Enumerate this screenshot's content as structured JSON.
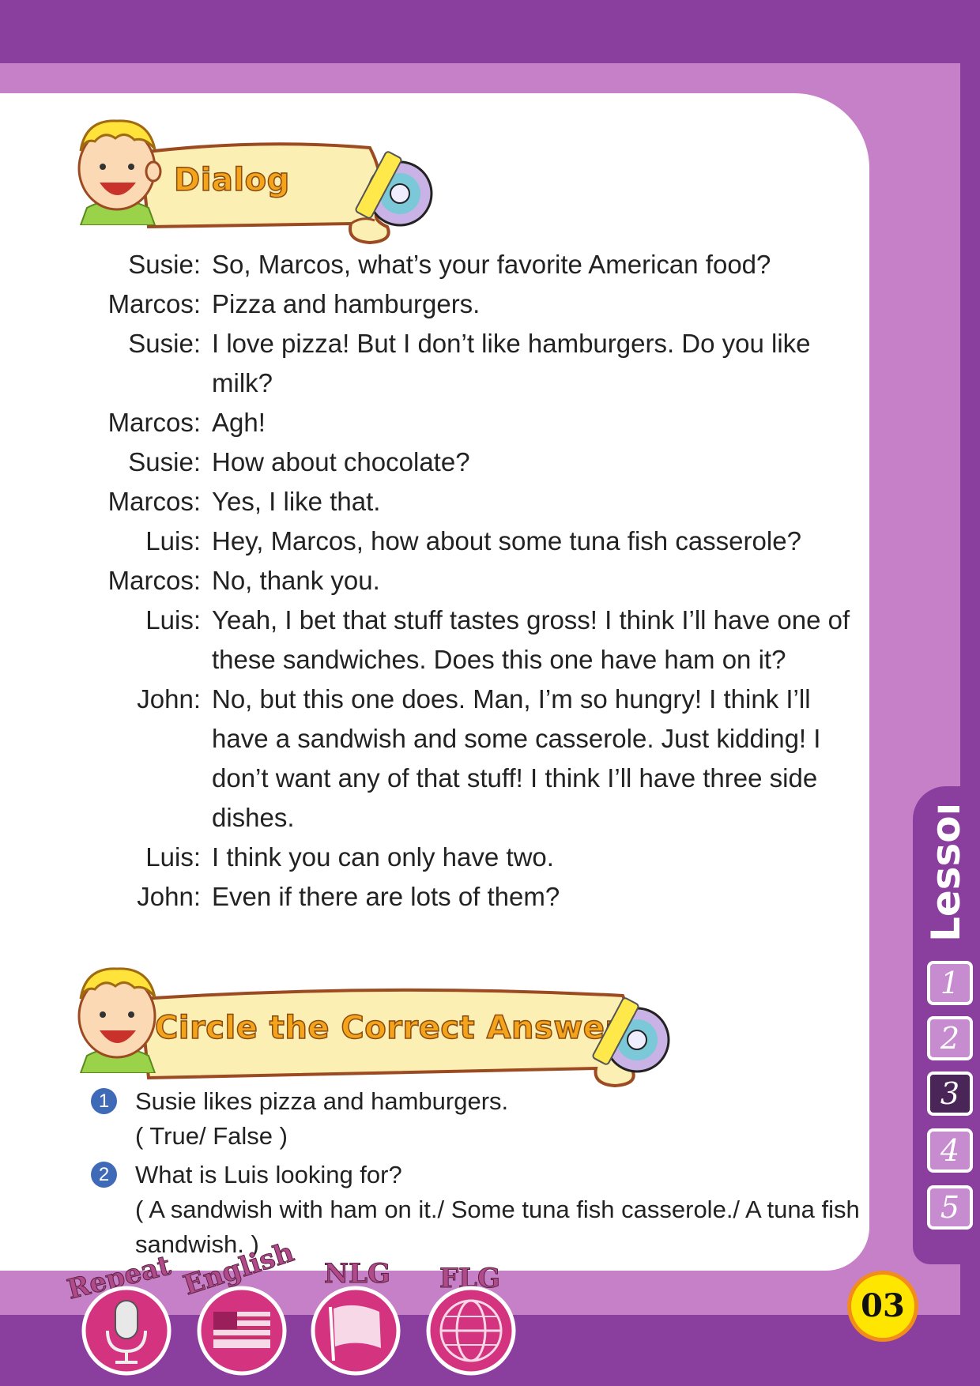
{
  "headers": {
    "dialog_title": "Dialog",
    "exercise_title": "Circle the Correct Answer"
  },
  "dialog": [
    {
      "speaker": "Susie:",
      "text": "So, Marcos, what’s your favorite American food?"
    },
    {
      "speaker": "Marcos:",
      "text": "Pizza and hamburgers."
    },
    {
      "speaker": "Susie:",
      "text": "I love pizza! But I don’t like hamburgers. Do you like milk?"
    },
    {
      "speaker": "Marcos:",
      "text": "Agh!"
    },
    {
      "speaker": "Susie:",
      "text": "How about chocolate?"
    },
    {
      "speaker": "Marcos:",
      "text": "Yes, I like that."
    },
    {
      "speaker": "Luis:",
      "text": "Hey, Marcos, how about some tuna fish casserole?"
    },
    {
      "speaker": "Marcos:",
      "text": "No, thank you."
    },
    {
      "speaker": "Luis:",
      "text": "Yeah, I bet that stuff tastes gross! I think I’ll have one of these sandwiches. Does this one have ham on it?"
    },
    {
      "speaker": "John:",
      "text": "No, but this one does. Man, I’m so hungry! I think I’ll have a sandwish and some casserole. Just kidding! I don’t want any of that stuff! I think I’ll have three side dishes."
    },
    {
      "speaker": "Luis:",
      "text": "I think you can only have two."
    },
    {
      "speaker": "John:",
      "text": "Even if there are lots of them?"
    }
  ],
  "questions": [
    {
      "number": "1",
      "question": "Susie likes pizza and hamburgers.",
      "options": "( True/ False )"
    },
    {
      "number": "2",
      "question": "What is Luis looking for?",
      "options": "( A sandwish with ham on it./ Some tuna fish casserole./ A tuna fish sandwish. )"
    }
  ],
  "lesson_tab": {
    "label": "Lesson",
    "numbers": [
      "1",
      "2",
      "3",
      "4",
      "5"
    ],
    "active": "3"
  },
  "page_number": "03",
  "badges": [
    {
      "label": "Repeat",
      "icon": "microphone-icon"
    },
    {
      "label": "English",
      "icon": "us-flag-icon"
    },
    {
      "label": "NLG",
      "icon": "flag-icon"
    },
    {
      "label": "FLG",
      "icon": "globe-icon"
    }
  ]
}
